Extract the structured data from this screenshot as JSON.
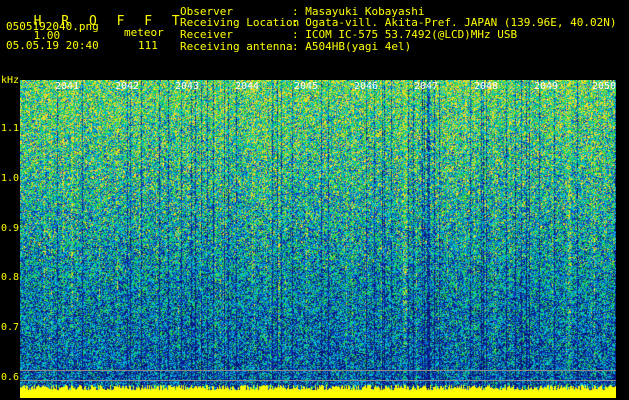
{
  "app": {
    "title": "H R O F F T",
    "version": "1.00",
    "filename": "0505192040.png",
    "datetime": "05.05.19 20:40",
    "count_label": "meteor",
    "count_value": "111"
  },
  "info": {
    "rows": [
      {
        "label": "Observer",
        "value": ": Masayuki Kobayashi"
      },
      {
        "label": "Receiving Location",
        "value": ": Ogata-vill. Akita-Pref. JAPAN (139.96E, 40.02N)"
      },
      {
        "label": "Receiver",
        "value": ": ICOM IC-575 53.7492(@LCD)MHz USB"
      },
      {
        "label": "Receiving antenna",
        "value": ": A504HB(yagi 4el)"
      }
    ]
  },
  "spectrogram": {
    "y_unit": "kHz",
    "y_ticks": [
      "1.1",
      "1.0",
      "0.9",
      "0.8",
      "0.7",
      "0.6"
    ],
    "minute_labels": [
      "2041",
      "2042",
      "2043",
      "2044",
      "2045",
      "2046",
      "2047",
      "2048",
      "2049",
      "2050"
    ],
    "colors": {
      "text": "#ffff00",
      "minute_label": "#ffffff",
      "background_noise": "#0a1e8c",
      "noise_cyan": "#00c8dc",
      "noise_green": "#28d246",
      "baseline_band": "#ffff00",
      "marker_line": "#8a8a8a"
    }
  }
}
